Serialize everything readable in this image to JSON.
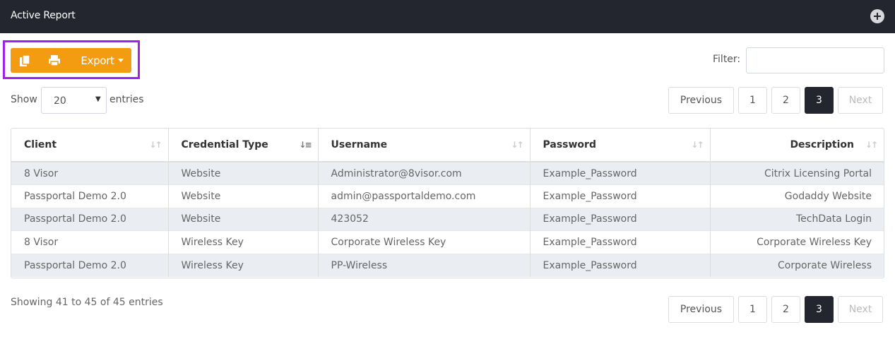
{
  "window": {
    "title": "Active Report"
  },
  "toolbar": {
    "copy_icon": "copy-icon",
    "print_icon": "print-icon",
    "export_label": "Export",
    "accent_color": "#f39c12",
    "highlight_color": "#a020f0"
  },
  "filter": {
    "label": "Filter:",
    "value": ""
  },
  "length": {
    "show_label": "Show",
    "value": "20",
    "entries_label": "entries"
  },
  "pagination": {
    "previous": "Previous",
    "pages": [
      "1",
      "2",
      "3"
    ],
    "current": "3",
    "next": "Next"
  },
  "table": {
    "columns": [
      "Client",
      "Credential Type",
      "Username",
      "Password",
      "Description"
    ],
    "sorted_column": "Credential Type",
    "rows": [
      [
        "8 Visor",
        "Website",
        "Administrator@8visor.com",
        "Example_Password",
        "Citrix Licensing Portal"
      ],
      [
        "Passportal Demo 2.0",
        "Website",
        "admin@passportaldemo.com",
        "Example_Password",
        "Godaddy Website"
      ],
      [
        "Passportal Demo 2.0",
        "Website",
        "423052",
        "Example_Password",
        "TechData Login"
      ],
      [
        "8 Visor",
        "Wireless Key",
        "Corporate Wireless Key",
        "Example_Password",
        "Corporate Wireless Key"
      ],
      [
        "Passportal Demo 2.0",
        "Wireless Key",
        "PP-Wireless",
        "Example_Password",
        "Corporate Wireless"
      ]
    ]
  },
  "info": "Showing 41 to 45 of 45 entries"
}
